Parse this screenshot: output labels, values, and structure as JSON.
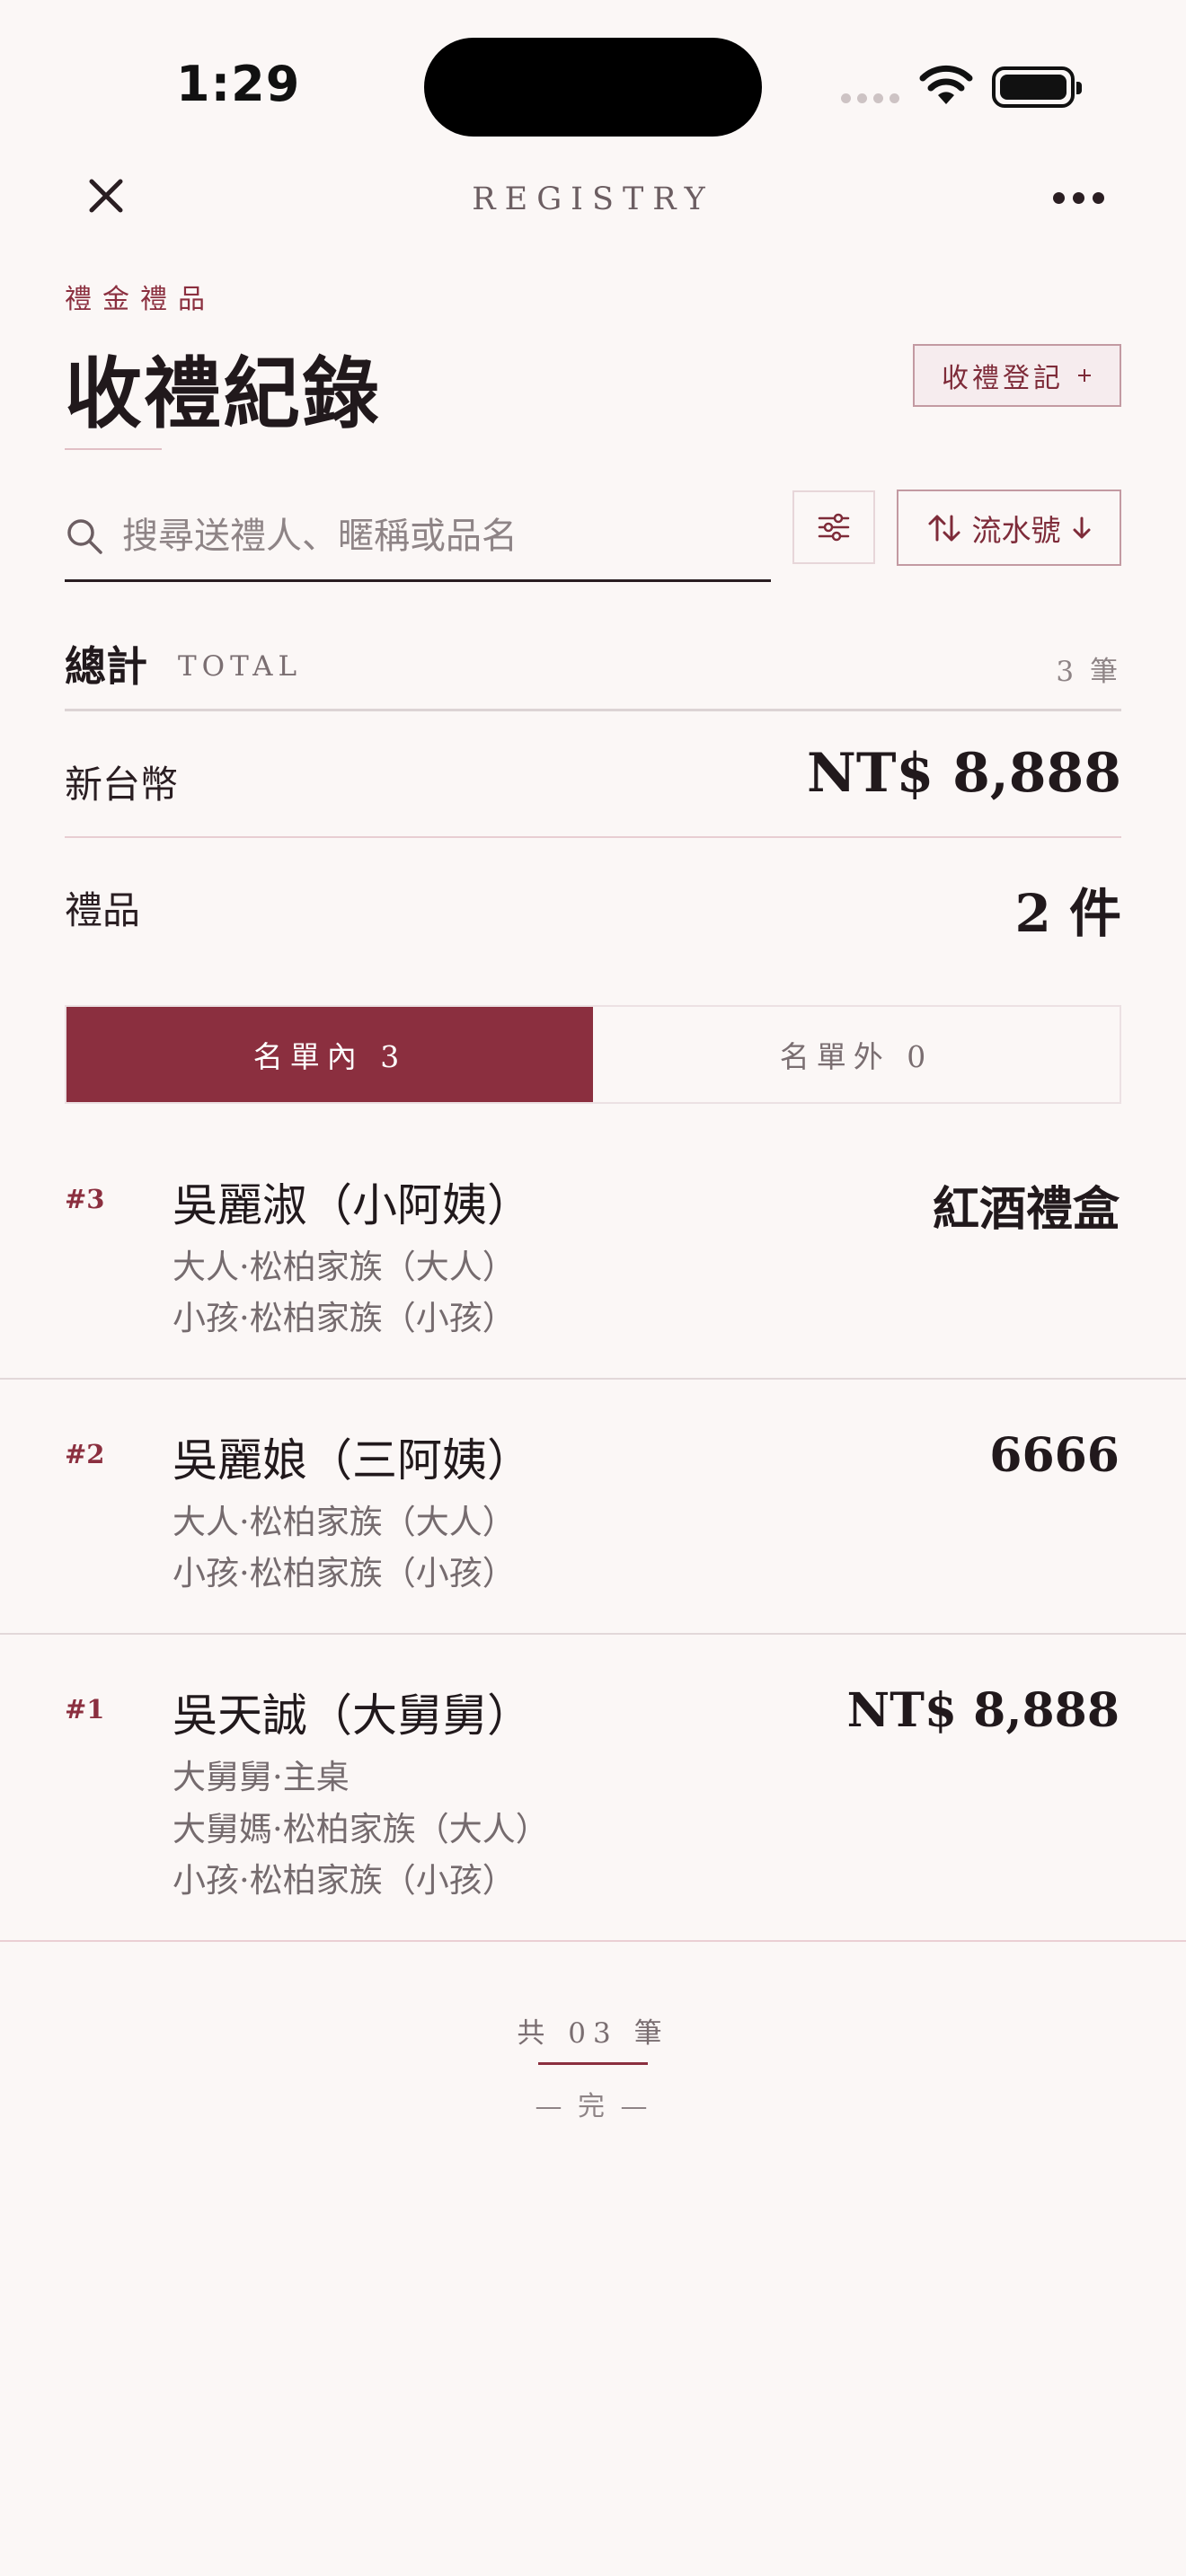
{
  "status_bar": {
    "time": "1:29"
  },
  "nav": {
    "title": "REGISTRY"
  },
  "header": {
    "eyebrow": "禮金禮品",
    "title": "收禮紀錄",
    "register_button": "收禮登記",
    "register_icon": "plus-icon"
  },
  "search": {
    "placeholder": "搜尋送禮人、暱稱或品名",
    "value": ""
  },
  "sort": {
    "label": "流水號"
  },
  "totals": {
    "label": "總計",
    "sub": "TOTAL",
    "count": "3 筆",
    "currency_label": "新台幣",
    "currency_value": "NT$ 8,888",
    "gift_label": "禮品",
    "gift_value": "2 件"
  },
  "tabs": [
    {
      "label": "名單內 3",
      "active": true
    },
    {
      "label": "名單外 0",
      "active": false
    }
  ],
  "records": [
    {
      "num": "#3",
      "name": "吳麗淑（小阿姨）",
      "details": [
        "大人·松柏家族（大人）",
        "小孩·松柏家族（小孩）"
      ],
      "gift": "紅酒禮盒"
    },
    {
      "num": "#2",
      "name": "吳麗娘（三阿姨）",
      "details": [
        "大人·松柏家族（大人）",
        "小孩·松柏家族（小孩）"
      ],
      "gift": "6666"
    },
    {
      "num": "#1",
      "name": "吳天誠（大舅舅）",
      "details": [
        "大舅舅·主桌",
        "大舅媽·松柏家族（大人）",
        "小孩·松柏家族（小孩）"
      ],
      "gift": "NT$ 8,888"
    }
  ],
  "footer": {
    "count": "共 03 筆",
    "end": "— 完 —"
  },
  "colors": {
    "accent": "#8B2F3F",
    "background": "#FBF7F6",
    "text": "#2A1E22"
  }
}
